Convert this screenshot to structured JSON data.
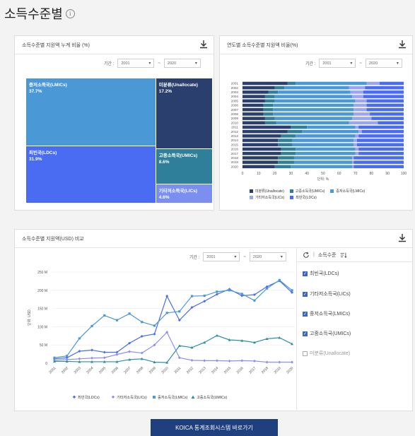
{
  "page": {
    "title": "소득수준별",
    "info_icon": "info-icon"
  },
  "treemap_panel": {
    "title": "소득수준별 지원액 누계 비율 (%)",
    "period_label": "기간 :",
    "from": "2001",
    "tilde": "~",
    "to": "2020",
    "cells": [
      {
        "name": "중저소득국(LMICs)",
        "value": "37.7%",
        "color": "#4b98d6"
      },
      {
        "name": "최빈국(LDCs)",
        "value": "31.9%",
        "color": "#4a6cf2"
      },
      {
        "name": "미분류(Unallocate)",
        "value": "17.2%",
        "color": "#2b3f6e"
      },
      {
        "name": "고중소득국(UMICs)",
        "value": "8.6%",
        "color": "#2f7f9a"
      },
      {
        "name": "기타저소득국(LICs)",
        "value": "4.6%",
        "color": "#7b8ff0"
      }
    ]
  },
  "stacked_panel": {
    "title": "연도별 소득수준별 지원액 비율(%)",
    "period_label": "기간 :",
    "from": "2001",
    "tilde": "~",
    "to": "2020",
    "x_title": "단위: %",
    "x_ticks": [
      "0",
      "10",
      "20",
      "30",
      "40",
      "50",
      "60",
      "70",
      "80",
      "90",
      "100"
    ],
    "legend": [
      {
        "name": "미분류(Unallocate)",
        "color": "#2b3f6e"
      },
      {
        "name": "고중소득국(UMICs)",
        "color": "#2f7f9a"
      },
      {
        "name": "중저소득국(LMICs)",
        "color": "#4b98d6"
      },
      {
        "name": "기타저소득국(LICs)",
        "color": "#9aa6f2"
      },
      {
        "name": "최빈국(LDCs)",
        "color": "#4a6cf2"
      }
    ]
  },
  "line_panel": {
    "title": "소득수준별 지원액(USD) 비교",
    "period_label": "기간 :",
    "from": "2001",
    "tilde": "~",
    "to": "2020",
    "y_title": "단위: USD",
    "side_head": "소득수준",
    "side_sep": "|",
    "checkboxes": [
      {
        "label": "최빈국(LDCs)",
        "checked": true
      },
      {
        "label": "기타저소득국(LICs)",
        "checked": true
      },
      {
        "label": "중저소득국(LMICs)",
        "checked": true
      },
      {
        "label": "고중소득국(UMICs)",
        "checked": true
      },
      {
        "label": "미분류(Unallocate)",
        "checked": false
      }
    ]
  },
  "koica_button": "KOICA 통계조회시스템 바로가기",
  "chart_data": [
    {
      "type": "treemap",
      "title": "소득수준별 지원액 누계 비율 (%)",
      "categories": [
        "중저소득국(LMICs)",
        "최빈국(LDCs)",
        "미분류(Unallocate)",
        "고중소득국(UMICs)",
        "기타저소득국(LICs)"
      ],
      "values": [
        37.7,
        31.9,
        17.2,
        8.6,
        4.6
      ]
    },
    {
      "type": "bar",
      "orientation": "horizontal",
      "stacked": true,
      "title": "연도별 소득수준별 지원액 비율(%)",
      "xlabel": "단위: %",
      "xlim": [
        0,
        100
      ],
      "categories": [
        "2001",
        "2002",
        "2003",
        "2004",
        "2005",
        "2006",
        "2007",
        "2008",
        "2009",
        "2010",
        "2011",
        "2012",
        "2013",
        "2014",
        "2015",
        "2016",
        "2017",
        "2018",
        "2019",
        "2020"
      ],
      "series": [
        {
          "name": "미분류(Unallocate)",
          "values": [
            28,
            20,
            16,
            14,
            14,
            13,
            13,
            13,
            14,
            14,
            30,
            28,
            24,
            22,
            22,
            24,
            24,
            22,
            22,
            20
          ]
        },
        {
          "name": "고중소득국(UMICs)",
          "values": [
            5,
            6,
            6,
            6,
            6,
            6,
            6,
            6,
            6,
            7,
            10,
            9,
            9,
            9,
            9,
            9,
            9,
            10,
            10,
            10
          ]
        },
        {
          "name": "중저소득국(LMICs)",
          "values": [
            44,
            40,
            45,
            48,
            50,
            50,
            50,
            50,
            48,
            45,
            30,
            35,
            37,
            38,
            38,
            37,
            37,
            36,
            36,
            38
          ]
        },
        {
          "name": "기타저소득국(LICs)",
          "values": [
            8,
            10,
            8,
            7,
            7,
            8,
            8,
            10,
            12,
            18,
            2,
            2,
            2,
            2,
            2,
            2,
            2,
            1,
            1,
            1
          ]
        },
        {
          "name": "최빈국(LDCs)",
          "values": [
            15,
            24,
            25,
            25,
            23,
            23,
            23,
            21,
            20,
            16,
            28,
            26,
            28,
            29,
            29,
            28,
            28,
            31,
            31,
            31
          ]
        }
      ]
    },
    {
      "type": "line",
      "title": "소득수준별 지원액(USD) 비교",
      "ylabel": "단위: USD",
      "ylim": [
        0,
        250
      ],
      "y_ticks": [
        "0",
        "50 M",
        "100 M",
        "150 M",
        "200 M",
        "250 M"
      ],
      "x": [
        "2001",
        "2002",
        "2003",
        "2004",
        "2005",
        "2006",
        "2007",
        "2008",
        "2009",
        "2010",
        "2011",
        "2012",
        "2013",
        "2014",
        "2015",
        "2016",
        "2017",
        "2018",
        "2019",
        "2020"
      ],
      "series": [
        {
          "name": "최빈국(LDCs)",
          "color": "#4a6cf2",
          "values": [
            12,
            15,
            33,
            36,
            30,
            30,
            55,
            74,
            80,
            184,
            118,
            153,
            170,
            189,
            203,
            185,
            188,
            210,
            226,
            194
          ]
        },
        {
          "name": "기타저소득국(LICs)",
          "color": "#8e8ef0",
          "values": [
            8,
            10,
            12,
            14,
            15,
            24,
            32,
            28,
            50,
            85,
            15,
            8,
            7,
            7,
            6,
            7,
            6,
            3,
            3,
            3
          ]
        },
        {
          "name": "중저소득국(LMICs)",
          "color": "#4b98d6",
          "values": [
            15,
            20,
            68,
            102,
            131,
            118,
            136,
            113,
            103,
            138,
            142,
            184,
            185,
            196,
            200,
            190,
            172,
            205,
            228,
            200
          ]
        },
        {
          "name": "고중소득국(UMICs)",
          "color": "#2f8f9f",
          "values": [
            5,
            5,
            4,
            4,
            4,
            4,
            10,
            12,
            3,
            2,
            48,
            43,
            57,
            76,
            64,
            62,
            57,
            67,
            70,
            53
          ]
        }
      ]
    }
  ]
}
